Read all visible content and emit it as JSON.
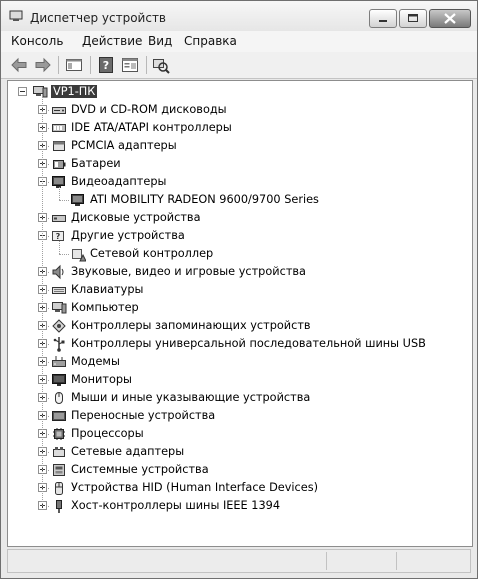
{
  "window": {
    "title": "Диспетчер устройств"
  },
  "menu": [
    "Консоль",
    "Действие",
    "Вид",
    "Справка"
  ],
  "toolbar": [
    "back-icon",
    "forward-icon",
    "show-hide-console-tree-icon",
    "help-icon",
    "properties-icon",
    "scan-hardware-icon"
  ],
  "tree": {
    "root": "VP1-ПК",
    "items": [
      {
        "label": "DVD и CD-ROM дисководы",
        "icon": "dvd-drive-icon",
        "expanded": false,
        "children": []
      },
      {
        "label": "IDE ATA/ATAPI контроллеры",
        "icon": "ide-controller-icon",
        "expanded": false,
        "children": []
      },
      {
        "label": "PCMCIA адаптеры",
        "icon": "pcmcia-icon",
        "expanded": false,
        "children": []
      },
      {
        "label": "Батареи",
        "icon": "battery-icon",
        "expanded": false,
        "children": []
      },
      {
        "label": "Видеоадаптеры",
        "icon": "display-adapter-icon",
        "expanded": true,
        "children": [
          {
            "label": "ATI MOBILITY RADEON 9600/9700 Series",
            "icon": "display-adapter-icon"
          }
        ]
      },
      {
        "label": "Дисковые устройства",
        "icon": "disk-drive-icon",
        "expanded": false,
        "children": []
      },
      {
        "label": "Другие устройства",
        "icon": "unknown-device-icon",
        "expanded": true,
        "children": [
          {
            "label": "Сетевой контроллер",
            "icon": "unknown-device-warning-icon"
          }
        ]
      },
      {
        "label": "Звуковые, видео и игровые устройства",
        "icon": "sound-icon",
        "expanded": false,
        "children": []
      },
      {
        "label": "Клавиатуры",
        "icon": "keyboard-icon",
        "expanded": false,
        "children": []
      },
      {
        "label": "Компьютер",
        "icon": "computer-icon",
        "expanded": false,
        "children": []
      },
      {
        "label": "Контроллеры запоминающих устройств",
        "icon": "storage-controller-icon",
        "expanded": false,
        "children": []
      },
      {
        "label": "Контроллеры универсальной последовательной шины USB",
        "icon": "usb-icon",
        "expanded": false,
        "children": []
      },
      {
        "label": "Модемы",
        "icon": "modem-icon",
        "expanded": false,
        "children": []
      },
      {
        "label": "Мониторы",
        "icon": "monitor-icon",
        "expanded": false,
        "children": []
      },
      {
        "label": "Мыши и иные указывающие устройства",
        "icon": "mouse-icon",
        "expanded": false,
        "children": []
      },
      {
        "label": "Переносные устройства",
        "icon": "portable-device-icon",
        "expanded": false,
        "children": []
      },
      {
        "label": "Процессоры",
        "icon": "processor-icon",
        "expanded": false,
        "children": []
      },
      {
        "label": "Сетевые адаптеры",
        "icon": "network-adapter-icon",
        "expanded": false,
        "children": []
      },
      {
        "label": "Системные устройства",
        "icon": "system-device-icon",
        "expanded": false,
        "children": []
      },
      {
        "label": "Устройства HID (Human Interface Devices)",
        "icon": "hid-icon",
        "expanded": false,
        "children": []
      },
      {
        "label": "Хост-контроллеры шины IEEE 1394",
        "icon": "ieee1394-icon",
        "expanded": false,
        "children": []
      }
    ]
  }
}
